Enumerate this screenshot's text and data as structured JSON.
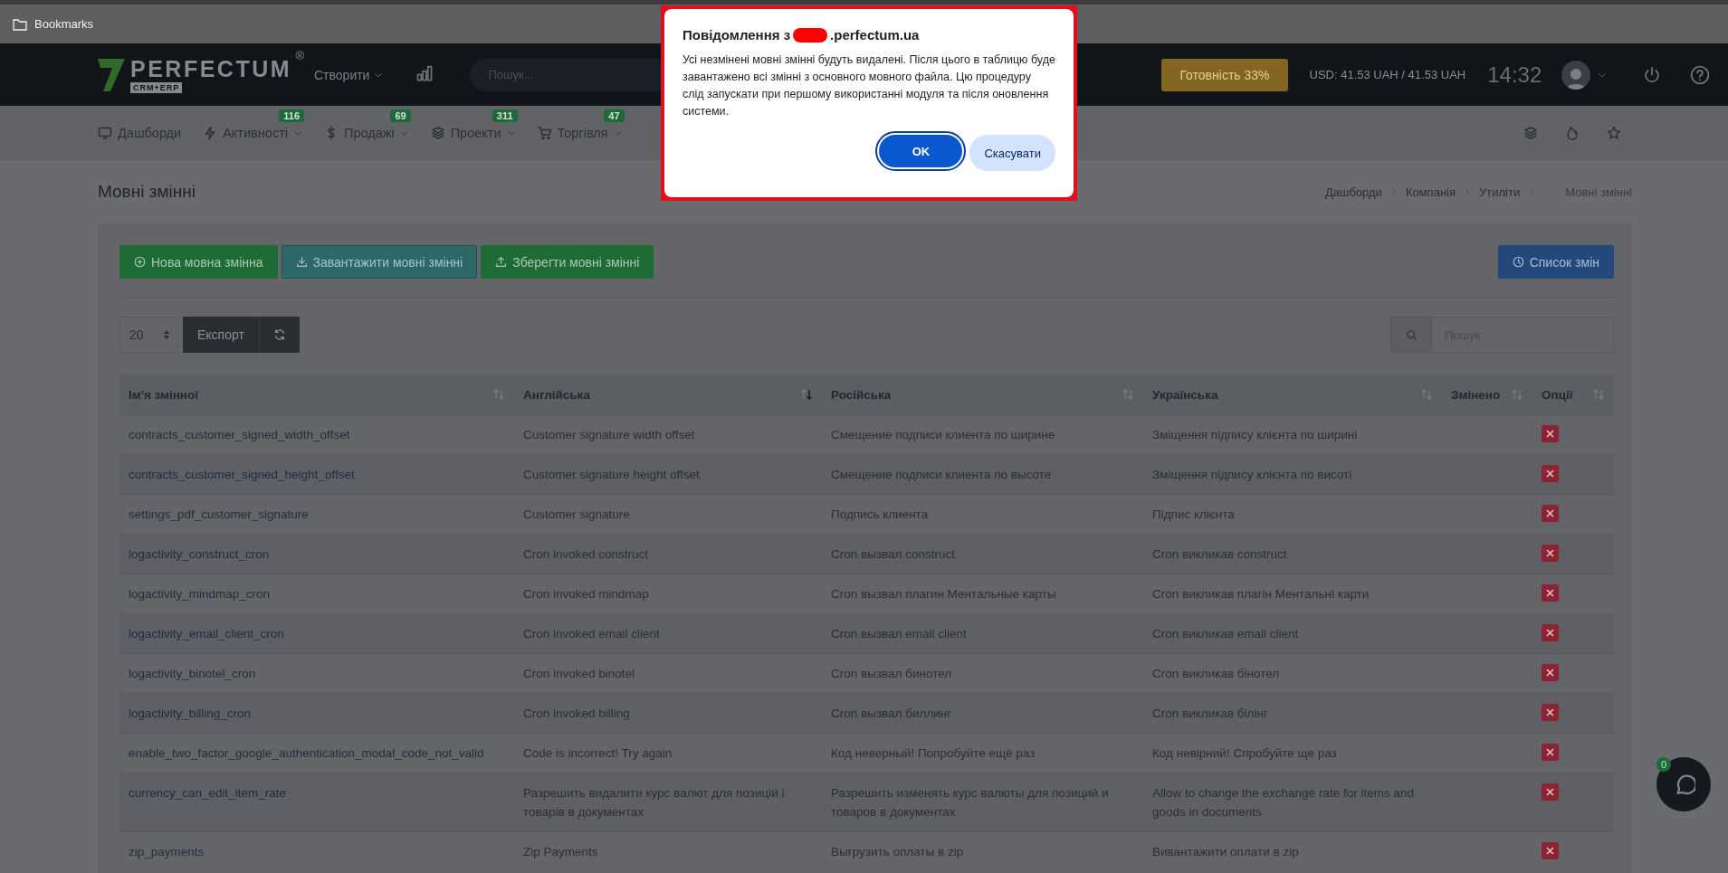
{
  "bookmarks_bar": {
    "label": "Bookmarks"
  },
  "header": {
    "logo": {
      "name": "PERFECTUM",
      "mark": "®",
      "tagline": "CRM+ERP"
    },
    "create_menu": "Створити",
    "search": {
      "placeholder": "Пошук..."
    },
    "readiness_button": "Готовність 33%",
    "currency": "USD: 41.53 UAH / 41.53 UAH",
    "time": "14:32"
  },
  "nav": {
    "items": [
      {
        "label": "Дашборди"
      },
      {
        "label": "Активності",
        "badge": "116"
      },
      {
        "label": "Продажі",
        "badge": "69"
      },
      {
        "label": "Проекти",
        "badge": "311"
      },
      {
        "label": "Торгівля",
        "badge": "47"
      }
    ]
  },
  "page": {
    "title": "Мовні змінні",
    "breadcrumbs": [
      {
        "label": "Дашборди",
        "current": false
      },
      {
        "label": "Компанія",
        "current": false
      },
      {
        "label": "Утиліти",
        "current": false
      },
      {
        "label": "Мовні змінні",
        "current": true
      }
    ]
  },
  "toolbar": {
    "buttons": [
      {
        "label": "Нова мовна змінна",
        "kind": "add"
      },
      {
        "label": "Завантажити мовні змінні",
        "kind": "download"
      },
      {
        "label": "Зберегти мовні змінні",
        "kind": "upload"
      }
    ],
    "history_button": "Список змін"
  },
  "table_controls": {
    "page_size": "20",
    "export_button": "Експорт",
    "search": {
      "placeholder": "Пошук:"
    }
  },
  "table": {
    "columns": [
      {
        "label": "Ім'я змінної",
        "sorted": false
      },
      {
        "label": "Англійська",
        "sorted": true
      },
      {
        "label": "Російська",
        "sorted": false
      },
      {
        "label": "Українська",
        "sorted": false
      },
      {
        "label": "Змінено",
        "sorted": false
      },
      {
        "label": "Опції",
        "sorted": false
      }
    ],
    "rows": [
      {
        "name": "contracts_customer_signed_width_offset",
        "english": "Customer signature width offset",
        "russian": "Смещение подписи клиента по ширине",
        "ukrainian": "Зміщення підпису клієнта по ширині"
      },
      {
        "name": "contracts_customer_signed_height_offset",
        "english": "Customer signature height offset",
        "russian": "Смещение подписи клиента по высоте",
        "ukrainian": "Зміщення підпису клієнта по висоті"
      },
      {
        "name": "settings_pdf_customer_signature",
        "english": "Customer signature",
        "russian": "Подпись клиента",
        "ukrainian": "Підпис клієнта"
      },
      {
        "name": "logactivity_construct_cron",
        "english": "Cron invoked construct",
        "russian": "Cron вызвал construct",
        "ukrainian": "Cron викликав construct"
      },
      {
        "name": "logactivity_mindmap_cron",
        "english": "Cron invoked mindmap",
        "russian": "Cron вызвал плагин Ментальные карты",
        "ukrainian": "Cron викликав плагін Ментальні карти"
      },
      {
        "name": "logactivity_email_client_cron",
        "english": "Cron invoked email client",
        "russian": "Cron вызвал email client",
        "ukrainian": "Cron викликав email client"
      },
      {
        "name": "logactivity_binotel_cron",
        "english": "Cron invoked binotel",
        "russian": "Cron вызвал бинотел",
        "ukrainian": "Cron викликав бінотел"
      },
      {
        "name": "logactivity_billing_cron",
        "english": "Cron invoked billing",
        "russian": "Cron вызвал биллинг",
        "ukrainian": "Cron викликав білінг"
      },
      {
        "name": "enable_two_factor_google_authentication_modal_code_not_valid",
        "english": "Code is incorrect! Try again",
        "russian": "Код неверный! Попробуйте ещё раз",
        "ukrainian": "Код невірний! Спробуйте ще раз"
      },
      {
        "name": "currency_can_edit_item_rate",
        "english": "Разрешить видалити курс валют для позицій і товарів в документах",
        "russian": "Разрешить изменять курс валюты для позиций и товаров в документах",
        "ukrainian": "Allow to change the exchange rate for items and goods in documents"
      },
      {
        "name": "zip_payments",
        "english": "Zip Payments",
        "russian": "Выгрузить оплаты в zip",
        "ukrainian": "Вивантажити оплати в zip"
      }
    ]
  },
  "dialog": {
    "title_prefix": "Повідомлення з",
    "title_suffix": ".perfectum.ua",
    "message": "Усі незмінені мовні змінні будуть видалені. Після цього в таблицю буде завантажено всі змінні з основного мовного файла. Цю процедуру слід запускати при першому використанні модуля та після оновлення системи.",
    "ok_button": "OK",
    "cancel_button": "Скасувати"
  },
  "chat": {
    "badge": "0"
  }
}
